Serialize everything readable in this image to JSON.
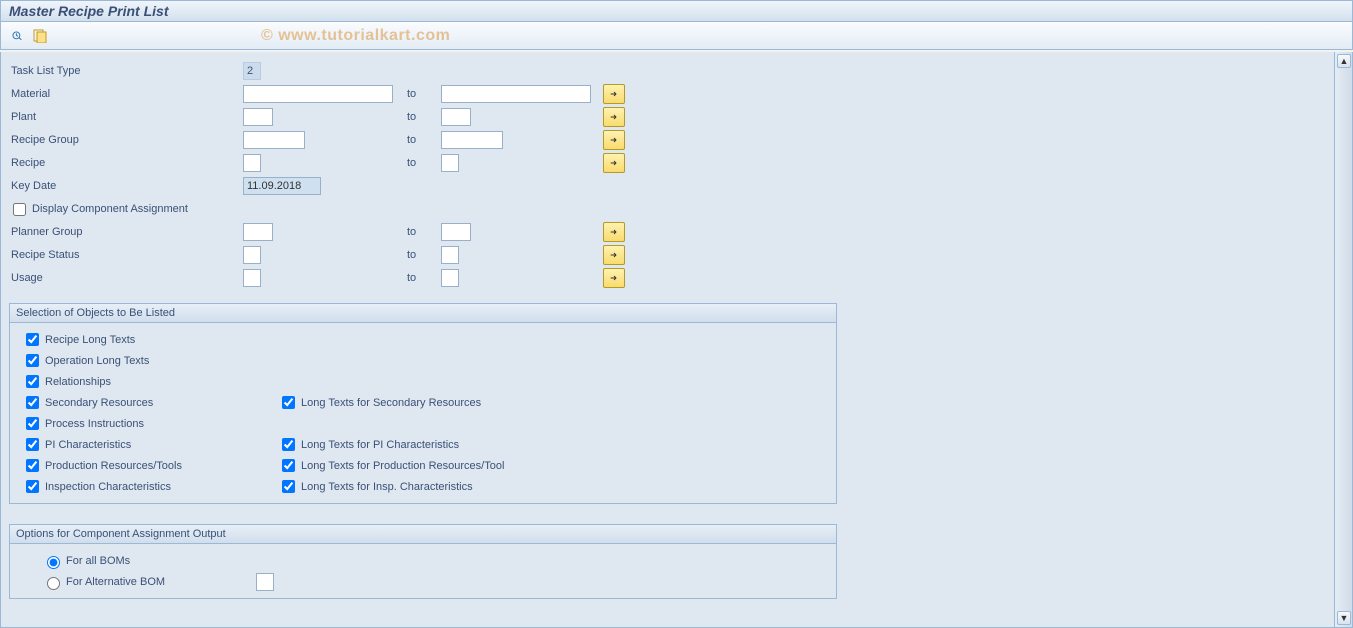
{
  "title": "Master Recipe Print List",
  "watermark": "© www.tutorialkart.com",
  "labels": {
    "task_list_type": "Task List Type",
    "material": "Material",
    "plant": "Plant",
    "recipe_group": "Recipe Group",
    "recipe": "Recipe",
    "key_date": "Key Date",
    "disp_comp_assign": "Display Component Assignment",
    "planner_group": "Planner Group",
    "recipe_status": "Recipe Status",
    "usage": "Usage",
    "to": "to"
  },
  "values": {
    "task_list_type": "2",
    "key_date": "11.09.2018"
  },
  "group1": {
    "title": "Selection of Objects to Be Listed",
    "recipe_long_texts": "Recipe Long Texts",
    "operation_long_texts": "Operation Long Texts",
    "relationships": "Relationships",
    "secondary_resources": "Secondary Resources",
    "long_sec_res": "Long Texts for Secondary Resources",
    "process_instructions": "Process Instructions",
    "pi_characteristics": "PI Characteristics",
    "long_pi_char": "Long Texts for PI Characteristics",
    "prod_res_tools": "Production Resources/Tools",
    "long_prod_res": "Long Texts for Production Resources/Tool",
    "insp_char": "Inspection Characteristics",
    "long_insp_char": "Long Texts for Insp. Characteristics"
  },
  "group2": {
    "title": "Options for Component Assignment Output",
    "for_all_boms": "For all BOMs",
    "for_alt_bom": "For Alternative BOM"
  }
}
